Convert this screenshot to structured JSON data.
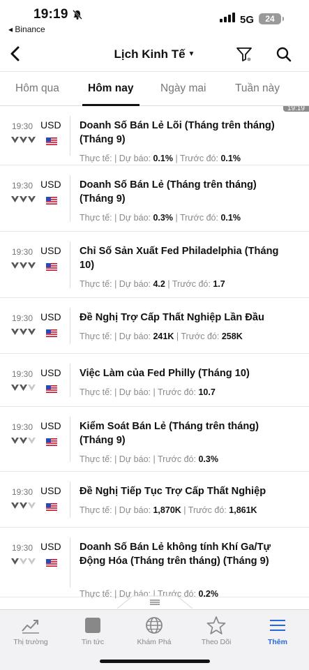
{
  "status_bar": {
    "time": "19:19",
    "back_app": "◂ Binance",
    "network": "5G",
    "battery": "24"
  },
  "header": {
    "title": "Lịch Kinh Tế"
  },
  "tabs": [
    {
      "label": "Hôm qua",
      "active": false
    },
    {
      "label": "Hôm nay",
      "active": true
    },
    {
      "label": "Ngày mai",
      "active": false
    },
    {
      "label": "Tuần này",
      "active": false
    }
  ],
  "time_stamp_marker": "19:19",
  "labels": {
    "actual": "Thực tế:",
    "forecast": "Dự báo:",
    "previous": "Trước đó:"
  },
  "events": [
    {
      "time": "19:30",
      "currency": "USD",
      "importance": 3,
      "title": "Doanh Số Bán Lẻ Lõi (Tháng trên tháng) (Tháng 9)",
      "actual": "",
      "forecast": "0.1%",
      "previous": "0.1%"
    },
    {
      "time": "19:30",
      "currency": "USD",
      "importance": 3,
      "title": "Doanh Số Bán Lẻ (Tháng trên tháng) (Tháng 9)",
      "actual": "",
      "forecast": "0.3%",
      "previous": "0.1%"
    },
    {
      "time": "19:30",
      "currency": "USD",
      "importance": 3,
      "title": "Chỉ Số Sản Xuất Fed Philadelphia (Tháng 10)",
      "actual": "",
      "forecast": "4.2",
      "previous": "1.7"
    },
    {
      "time": "19:30",
      "currency": "USD",
      "importance": 3,
      "title": "Đề Nghị Trợ Cấp Thất Nghiệp Lần Đầu",
      "actual": "",
      "forecast": "241K",
      "previous": "258K"
    },
    {
      "time": "19:30",
      "currency": "USD",
      "importance": 2,
      "title": "Việc Làm của Fed Philly (Tháng 10)",
      "actual": "",
      "forecast": "",
      "previous": "10.7"
    },
    {
      "time": "19:30",
      "currency": "USD",
      "importance": 2,
      "title": "Kiểm Soát Bán Lẻ (Tháng trên tháng) (Tháng 9)",
      "actual": "",
      "forecast": "",
      "previous": "0.3%"
    },
    {
      "time": "19:30",
      "currency": "USD",
      "importance": 2,
      "title": "Đề Nghị Tiếp Tục Trợ Cấp Thất Nghiệp",
      "actual": "",
      "forecast": "1,870K",
      "previous": "1,861K"
    },
    {
      "time": "19:30",
      "currency": "USD",
      "importance": 1,
      "title": "Doanh Số Bán Lẻ không tính Khí Ga/Tự Động Hóa (Tháng trên tháng) (Tháng 9)",
      "actual": "",
      "forecast": "",
      "previous": "0.2%"
    }
  ],
  "bottom_nav": [
    {
      "label": "Thị trường",
      "icon": "chart-line-icon",
      "active": false
    },
    {
      "label": "Tin tức",
      "icon": "news-icon",
      "active": false
    },
    {
      "label": "Khám Phá",
      "icon": "globe-icon",
      "active": false
    },
    {
      "label": "Theo Dõi",
      "icon": "star-icon",
      "active": false
    },
    {
      "label": "Thêm",
      "icon": "menu-icon",
      "active": true
    }
  ],
  "colors": {
    "accent": "#2a67d8",
    "bull_active": "#555555",
    "bull_inactive": "#c8c8c8"
  }
}
